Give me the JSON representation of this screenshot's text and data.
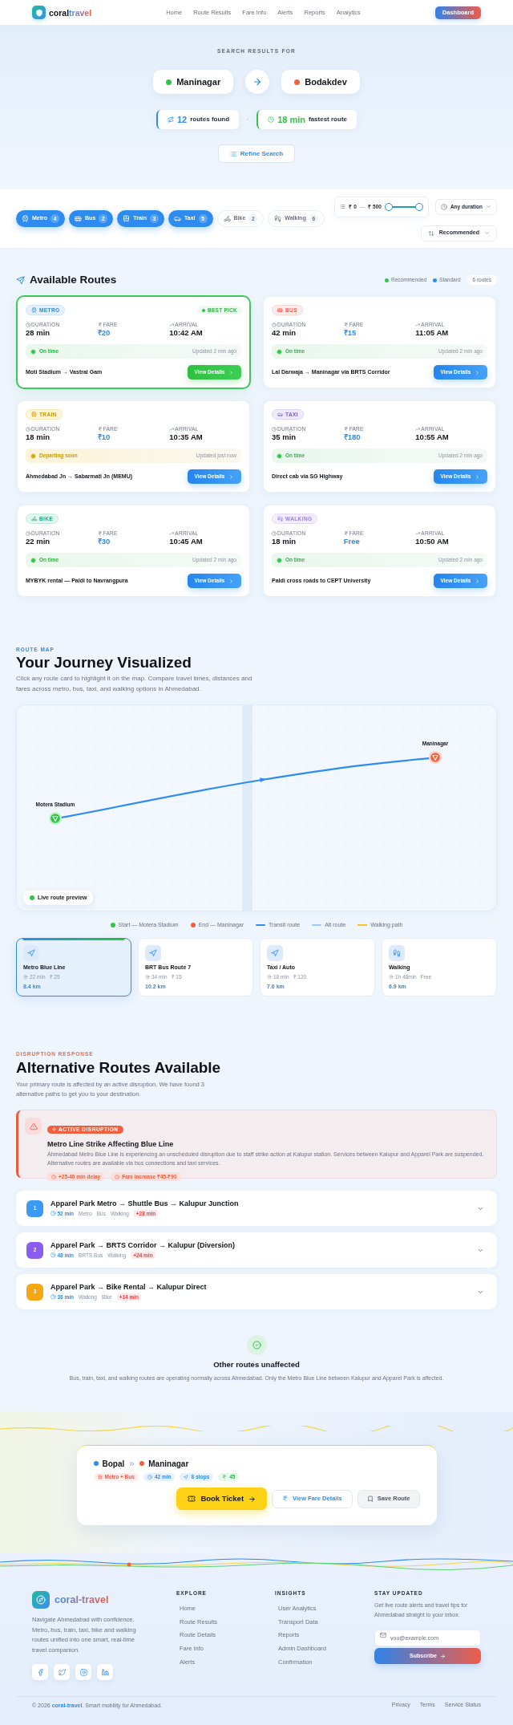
{
  "header": {
    "logo": {
      "first": "coral",
      "second": "travel"
    },
    "nav": [
      {
        "label": "Home",
        "selected": false
      },
      {
        "label": "Route Results",
        "selected": false
      },
      {
        "label": "Fare Info",
        "selected": false
      },
      {
        "label": "Alerts",
        "selected": false
      },
      {
        "label": "Reports",
        "selected": false
      },
      {
        "label": "Analytics",
        "selected": false
      }
    ],
    "cta": "Dashboard"
  },
  "search": {
    "eyebrow": "SEARCH RESULTS FOR",
    "origin": {
      "name": "Maninagar",
      "color": "#2fc548"
    },
    "destination": {
      "name": "Bodakdev",
      "color": "#f2603d"
    },
    "stats": [
      {
        "kind": "routes",
        "value": "12",
        "label": "routes found"
      },
      {
        "kind": "time",
        "value": "18 min",
        "label": "fastest route"
      }
    ],
    "refine_button": "Refine Search"
  },
  "filters": {
    "modes": [
      {
        "kind": "metro",
        "label": "Metro",
        "count": "4",
        "selected": true
      },
      {
        "kind": "bus",
        "label": "Bus",
        "count": "2",
        "selected": true
      },
      {
        "kind": "train",
        "label": "Train",
        "count": "3",
        "selected": true
      },
      {
        "kind": "taxi",
        "label": "Taxi",
        "count": "5",
        "selected": true
      },
      {
        "kind": "bike",
        "label": "Bike",
        "count": "2",
        "selected": false
      },
      {
        "kind": "walking",
        "label": "Walking",
        "count": "6",
        "selected": false
      }
    ],
    "price": {
      "min": "₹ 0",
      "separator": "—",
      "max": "₹ 500",
      "level": 1
    },
    "duration": "Any duration",
    "sort": "Recommended"
  },
  "available": {
    "title": "Available Routes",
    "legend": [
      {
        "label": "Recommended",
        "color": "#2fc548"
      },
      {
        "label": "Standard",
        "color": "#2e8cf0"
      }
    ],
    "count": "6 routes",
    "cards": [
      {
        "kind": "metro",
        "tag": "METRO",
        "badge": "BEST PICK",
        "recommended": true,
        "stats": [
          {
            "kind": "duration",
            "label": "DURATION",
            "value": "28 min"
          },
          {
            "kind": "fare",
            "label": "FARE",
            "value": "₹20"
          },
          {
            "kind": "arrival",
            "label": "ARRIVAL",
            "value": "10:42 AM"
          }
        ],
        "status": {
          "kind": "on_time",
          "text": "On time"
        },
        "updated": "Updated 2 min ago",
        "route": "Moti Stadium → Vastral Gam",
        "button": "View Details"
      },
      {
        "kind": "bus",
        "tag": "BUS",
        "recommended": false,
        "stats": [
          {
            "kind": "duration",
            "label": "DURATION",
            "value": "42 min"
          },
          {
            "kind": "fare",
            "label": "FARE",
            "value": "₹15"
          },
          {
            "kind": "arrival",
            "label": "ARRIVAL",
            "value": "11:05 AM"
          }
        ],
        "status": {
          "kind": "on_time",
          "text": "On time"
        },
        "updated": "Updated 2 min ago",
        "route": "Lal Darwaja → Maninagar via BRTS Corridor",
        "button": "View Details"
      },
      {
        "kind": "train",
        "tag": "TRAIN",
        "recommended": false,
        "stats": [
          {
            "kind": "duration",
            "label": "DURATION",
            "value": "18 min"
          },
          {
            "kind": "fare",
            "label": "FARE",
            "value": "₹10"
          },
          {
            "kind": "arrival",
            "label": "ARRIVAL",
            "value": "10:35 AM"
          }
        ],
        "status": {
          "kind": "departing",
          "text": "Departing soon"
        },
        "updated": "Updated just now",
        "route": "Ahmedabad Jn → Sabarmati Jn (MEMU)",
        "button": "View Details"
      },
      {
        "kind": "taxi",
        "tag": "TAXI",
        "recommended": false,
        "stats": [
          {
            "kind": "duration",
            "label": "DURATION",
            "value": "35 min"
          },
          {
            "kind": "fare",
            "label": "FARE",
            "value": "₹180"
          },
          {
            "kind": "arrival",
            "label": "ARRIVAL",
            "value": "10:55 AM"
          }
        ],
        "status": {
          "kind": "on_time",
          "text": "On time"
        },
        "updated": "Updated 2 min ago",
        "route": "Direct cab via SG Highway",
        "button": "View Details"
      },
      {
        "kind": "bike",
        "tag": "BIKE",
        "recommended": false,
        "stats": [
          {
            "kind": "duration",
            "label": "DURATION",
            "value": "22 min"
          },
          {
            "kind": "fare",
            "label": "FARE",
            "value": "₹30"
          },
          {
            "kind": "arrival",
            "label": "ARRIVAL",
            "value": "10:45 AM"
          }
        ],
        "status": {
          "kind": "on_time",
          "text": "On time"
        },
        "updated": "Updated 2 min ago",
        "route": "MYBYK rental — Paldi to Navrangpura",
        "button": "View Details"
      },
      {
        "kind": "walking",
        "tag": "WALKING",
        "recommended": false,
        "stats": [
          {
            "kind": "duration",
            "label": "DURATION",
            "value": "18 min"
          },
          {
            "kind": "fare",
            "label": "FARE",
            "value": "Free"
          },
          {
            "kind": "arrival",
            "label": "ARRIVAL",
            "value": "10:50 AM"
          }
        ],
        "status": {
          "kind": "on_time",
          "text": "On time"
        },
        "updated": "Updated 2 min ago",
        "route": "Paldi cross roads to CEPT University",
        "button": "View Details"
      }
    ]
  },
  "map_section": {
    "eyebrow": "ROUTE MAP",
    "title": "Your Journey Visualized",
    "description": "Click any route card to highlight it on the map. Compare travel times, distances and fares across metro, bus, taxi, and walking options in Ahmedabad.",
    "map": {
      "start_label": "Motera Stadium",
      "end_label": "Maninagar",
      "badge": "Live route preview"
    },
    "legend": [
      {
        "kind": "dot",
        "label": "Start — Motera Stadium",
        "color": "#2fc548"
      },
      {
        "kind": "dot",
        "label": "End — Maninagar",
        "color": "#f2603d"
      },
      {
        "kind": "line",
        "label": "Transit route",
        "color": "#2e8cf0"
      },
      {
        "kind": "line",
        "label": "Alt route",
        "color": "#9cc8f5"
      },
      {
        "kind": "dashed",
        "label": "Walking path",
        "color": "#f5c518"
      }
    ],
    "options": [
      {
        "kind": "transit",
        "name": "Metro Blue Line",
        "time": "22 min",
        "fare": "₹ 25",
        "distance": "8.4 km",
        "selected": true
      },
      {
        "kind": "transit",
        "name": "BRT Bus Route 7",
        "time": "34 min",
        "fare": "₹ 15",
        "distance": "10.2 km",
        "selected": false
      },
      {
        "kind": "transit",
        "name": "Taxi / Auto",
        "time": "18 min",
        "fare": "₹ 120",
        "distance": "7.6 km",
        "selected": false
      },
      {
        "kind": "walking",
        "name": "Walking",
        "time": "1h 48min",
        "fare": "Free",
        "distance": "6.9 km",
        "selected": false
      }
    ]
  },
  "disruption": {
    "eyebrow": "DISRUPTION RESPONSE",
    "title": "Alternative Routes Available",
    "description": "Your primary route is affected by an active disruption. We have found 3 alternative paths to get you to your destination.",
    "alert": {
      "badge": "ACTIVE DISRUPTION",
      "title": "Metro Line Strike Affecting Blue Line",
      "text": "Ahmedabad Metro Blue Line is experiencing an unscheduled disruption due to staff strike action at Kalupur station. Services between Kalupur and Apparel Park are suspended. Alternative routes are available via bus connections and taxi services.",
      "impacts": [
        {
          "kind": "delay",
          "text": "+25-40 min delay"
        },
        {
          "kind": "fare",
          "text": "Fare increase ₹45-₹90"
        }
      ]
    },
    "alternatives": [
      {
        "number": "1",
        "color": "#3b9af5",
        "title": "Apparel Park Metro → Shuttle Bus → Kalupur Junction",
        "time": "52 min",
        "modes": [
          "Metro",
          "Bus",
          "Walking"
        ],
        "delay": "+28 min",
        "expanded": false
      },
      {
        "number": "2",
        "color": "#8b5cf0",
        "title": "Apparel Park → BRTS Corridor → Kalupur (Diversion)",
        "time": "48 min",
        "modes": [
          "BRTS Bus",
          "Walking"
        ],
        "delay": "+24 min",
        "expanded": false
      },
      {
        "number": "3",
        "color": "#f5a614",
        "title": "Apparel Park → Bike Rental → Kalupur Direct",
        "time": "38 min",
        "modes": [
          "Walking",
          "Bike"
        ],
        "delay": "+14 min",
        "expanded": false
      }
    ],
    "unaffected": {
      "title": "Other routes unaffected",
      "text": "Bus, train, taxi, and walking routes are operating normally across Ahmedabad. Only the Metro Blue Line between Kalupur and Apparel Park is affected."
    }
  },
  "booking": {
    "origin": {
      "name": "Bopal",
      "color": "#2e8cf0"
    },
    "destination": {
      "name": "Maninagar",
      "color": "#f2603d"
    },
    "chips": [
      {
        "kind": "mode",
        "text": "Metro + Bus"
      },
      {
        "kind": "time",
        "text": "42 min"
      },
      {
        "kind": "stops",
        "text": "8 stops"
      },
      {
        "kind": "fare",
        "text": "45"
      }
    ],
    "buttons": [
      {
        "kind": "primary",
        "label": "Book Ticket"
      },
      {
        "kind": "secondary",
        "label": "View Fare Details"
      },
      {
        "kind": "tertiary",
        "label": "Save Route"
      }
    ]
  },
  "footer": {
    "brand": "coral-travel",
    "description": "Navigate Ahmedabad with confidence. Metro, bus, train, taxi, bike and walking routes unified into one smart, real-time travel companion.",
    "socials": [
      {
        "kind": "facebook"
      },
      {
        "kind": "twitter"
      },
      {
        "kind": "instagram"
      },
      {
        "kind": "linkedin"
      }
    ],
    "columns": [
      {
        "title": "EXPLORE",
        "links": [
          "Home",
          "Route Results",
          "Route Details",
          "Fare Info",
          "Alerts"
        ]
      },
      {
        "title": "INSIGHTS",
        "links": [
          "User Analytics",
          "Transport Data",
          "Reports",
          "Admin Dashboard",
          "Confirmation"
        ]
      }
    ],
    "newsletter": {
      "title": "STAY UPDATED",
      "text": "Get live route alerts and travel tips for Ahmedabad straight to your inbox.",
      "placeholder": "you@example.com",
      "button": "Subscribe"
    },
    "copyright": {
      "prefix": "© 2026",
      "brand": "coral-travel",
      "suffix": ". Smart mobility for Ahmedabad."
    },
    "legal": [
      "Privacy",
      "Terms",
      "Service Status"
    ]
  }
}
